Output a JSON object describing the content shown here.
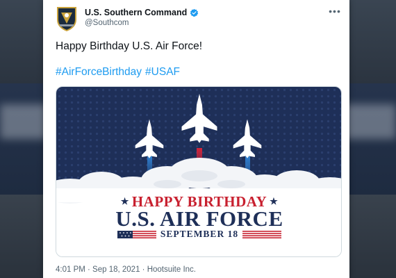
{
  "account": {
    "display_name": "U.S. Southern Command",
    "handle": "@Southcom",
    "verified": true,
    "avatar_icon": "southcom-crest-icon"
  },
  "more_icon": "more-horizontal-icon",
  "tweet": {
    "text": "Happy Birthday U.S. Air Force!",
    "hashtags": [
      "#AirForceBirthday",
      "#USAF"
    ]
  },
  "media": {
    "banner_line1": "HAPPY BIRTHDAY",
    "banner_line2": "U.S. AIR FORCE",
    "banner_date": "SEPTEMBER 18",
    "jet_icon": "fighter-jet-icon",
    "colors": {
      "navy": "#1e2f58",
      "red": "#c8202f",
      "contrail_blue": "#2f7fd0",
      "contrail_red": "#d8243a"
    }
  },
  "meta": {
    "timestamp": "4:01 PM · Sep 18, 2021 · Hootsuite Inc."
  },
  "colors": {
    "link": "#1d9bf0",
    "text": "#0f1419",
    "secondary": "#536471"
  }
}
